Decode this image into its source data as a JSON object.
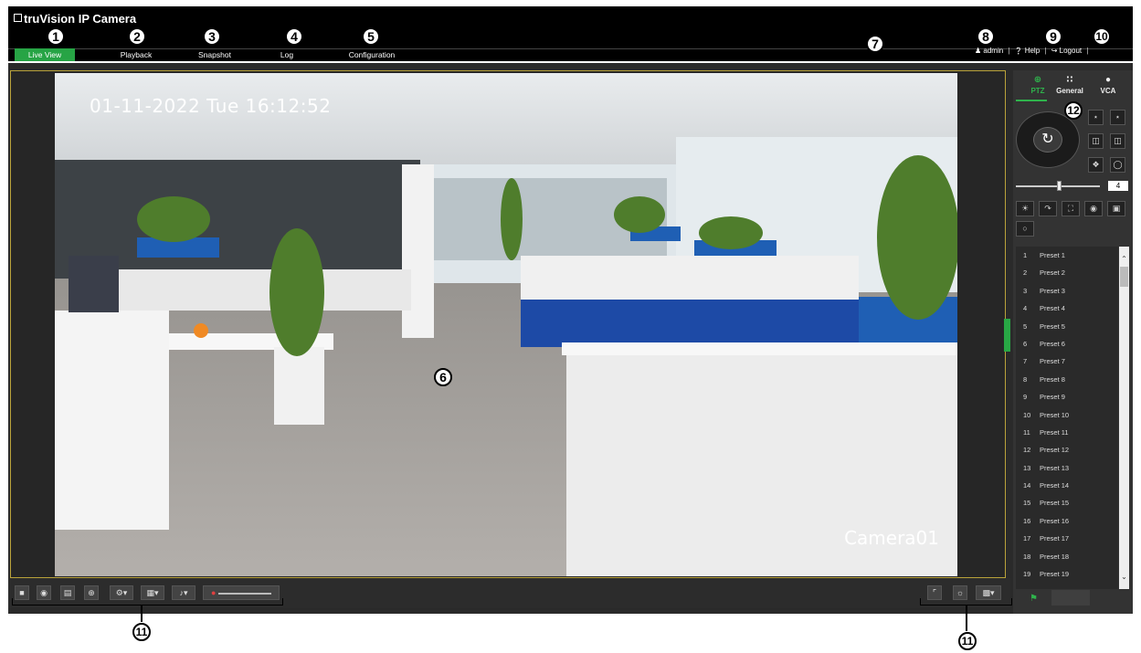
{
  "app": {
    "brand": "truVision",
    "product": "IP Camera"
  },
  "nav": {
    "tabs": [
      {
        "label": "Live View",
        "active": true
      },
      {
        "label": "Playback"
      },
      {
        "label": "Snapshot"
      },
      {
        "label": "Log"
      },
      {
        "label": "Configuration"
      }
    ]
  },
  "user": {
    "name": "admin",
    "help": "Help",
    "logout": "Logout",
    "separator": "|"
  },
  "video": {
    "osd_datetime": "01-11-2022 Tue 16:12:52",
    "osd_camera": "Camera01"
  },
  "ptz": {
    "tabs": [
      {
        "label": "PTZ",
        "active": true
      },
      {
        "label": "General"
      },
      {
        "label": "VCA"
      }
    ],
    "speed": "4",
    "presets": [
      {
        "n": "1",
        "label": "Preset 1"
      },
      {
        "n": "2",
        "label": "Preset 2"
      },
      {
        "n": "3",
        "label": "Preset 3"
      },
      {
        "n": "4",
        "label": "Preset 4"
      },
      {
        "n": "5",
        "label": "Preset 5"
      },
      {
        "n": "6",
        "label": "Preset 6"
      },
      {
        "n": "7",
        "label": "Preset 7"
      },
      {
        "n": "8",
        "label": "Preset 8"
      },
      {
        "n": "9",
        "label": "Preset 9"
      },
      {
        "n": "10",
        "label": "Preset 10"
      },
      {
        "n": "11",
        "label": "Preset 11"
      },
      {
        "n": "12",
        "label": "Preset 12"
      },
      {
        "n": "13",
        "label": "Preset 13"
      },
      {
        "n": "14",
        "label": "Preset 14"
      },
      {
        "n": "15",
        "label": "Preset 15"
      },
      {
        "n": "16",
        "label": "Preset 16"
      },
      {
        "n": "17",
        "label": "Preset 17"
      },
      {
        "n": "18",
        "label": "Preset 18"
      },
      {
        "n": "19",
        "label": "Preset 19"
      }
    ]
  },
  "callouts": {
    "c1": "1",
    "c2": "2",
    "c3": "3",
    "c4": "4",
    "c5": "5",
    "c6": "6",
    "c7": "7",
    "c8": "8",
    "c9": "9",
    "c10": "10",
    "c11": "11",
    "c12": "12"
  },
  "colors": {
    "accent_green": "#27a445",
    "frame_gold": "#b9a23a",
    "topbar_bg": "#000000",
    "panel_bg": "#333333"
  }
}
